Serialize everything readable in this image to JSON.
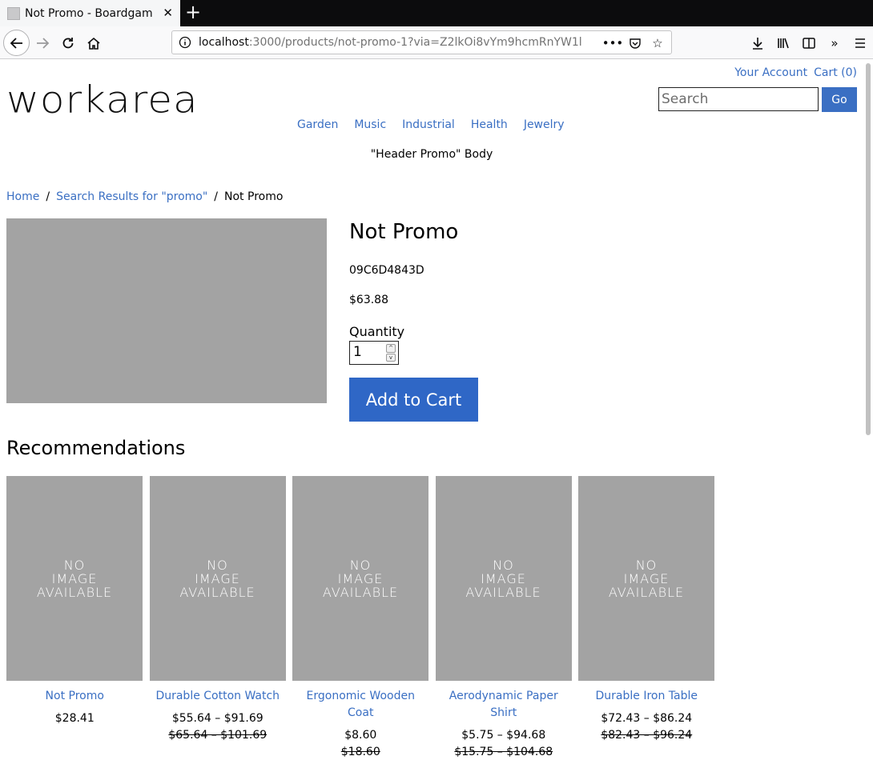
{
  "browser": {
    "tab_title": "Not Promo - Boardgame",
    "url_host": "localhost",
    "url_rest": ":3000/products/not-promo-1?via=Z2lkOi8vYm9hcmRnYW1l"
  },
  "header": {
    "logo": "workarea",
    "account_link": "Your Account",
    "cart_link": "Cart (0)",
    "search_placeholder": "Search",
    "search_button": "Go",
    "categories": [
      "Garden",
      "Music",
      "Industrial",
      "Health",
      "Jewelry"
    ],
    "promo": "\"Header Promo\" Body"
  },
  "breadcrumb": {
    "home": "Home",
    "search": "Search Results for \"promo\"",
    "current": "Not Promo",
    "separator": "/"
  },
  "product": {
    "name": "Not Promo",
    "sku": "09C6D4843D",
    "price": "$63.88",
    "quantity_label": "Quantity",
    "quantity_value": "1",
    "add_to_cart": "Add to Cart"
  },
  "recommendations": {
    "heading": "Recommendations",
    "no_image": [
      "NO",
      "IMAGE",
      "AVAILABLE"
    ],
    "items": [
      {
        "name": "Not Promo",
        "price": "$28.41",
        "original": ""
      },
      {
        "name": "Durable Cotton Watch",
        "price": "$55.64 – $91.69",
        "original": "$65.64 – $101.69"
      },
      {
        "name": "Ergonomic Wooden Coat",
        "price": "$8.60",
        "original": "$18.60"
      },
      {
        "name": "Aerodynamic Paper Shirt",
        "price": "$5.75 – $94.68",
        "original": "$15.75 – $104.68"
      },
      {
        "name": "Durable Iron Table",
        "price": "$72.43 – $86.24",
        "original": "$82.43 – $96.24"
      }
    ]
  }
}
